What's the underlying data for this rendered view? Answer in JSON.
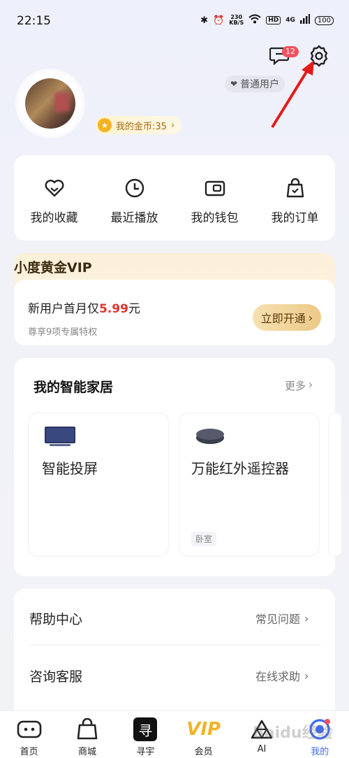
{
  "status_bar": {
    "time": "22:15",
    "speed_value": "230",
    "speed_unit": "KB/S",
    "hd": "HD",
    "network": "4G",
    "battery": "100"
  },
  "header": {
    "message_badge": "12",
    "user_type": "普通用户",
    "coins_label": "我的金币:35"
  },
  "quick_actions": [
    {
      "label": "我的收藏",
      "icon": "heart-icon"
    },
    {
      "label": "最近播放",
      "icon": "clock-icon"
    },
    {
      "label": "我的钱包",
      "icon": "wallet-icon"
    },
    {
      "label": "我的订单",
      "icon": "shopping-bag-icon"
    }
  ],
  "vip": {
    "title": "小度黄金VIP",
    "offer_prefix": "新用户首月仅",
    "offer_price": "5.99",
    "offer_suffix": "元",
    "subtitle": "尊享9项专属特权",
    "button": "立即开通"
  },
  "smart_home": {
    "title": "我的智能家居",
    "more": "更多",
    "devices": [
      {
        "name": "智能投屏",
        "room": ""
      },
      {
        "name": "万能红外遥控器",
        "room": "卧室"
      }
    ]
  },
  "list": [
    {
      "title": "帮助中心",
      "value": "常见问题"
    },
    {
      "title": "咨询客服",
      "value": "在线求助"
    }
  ],
  "tabs": [
    {
      "label": "首页",
      "icon": "home-tv-icon"
    },
    {
      "label": "商城",
      "icon": "shopping-bag-icon"
    },
    {
      "label": "寻宇",
      "icon": "xunyu-logo-icon"
    },
    {
      "label": "会员",
      "icon": "vip-icon"
    },
    {
      "label": "AI",
      "icon": "ai-triangle-icon"
    },
    {
      "label": "我的",
      "icon": "profile-icon"
    }
  ],
  "watermark": "Baidu经验",
  "colors": {
    "accent_red": "#e0342f",
    "badge_red": "#f3515f",
    "vip_gold": "#ecc987",
    "active_blue": "#3b6cf6"
  }
}
